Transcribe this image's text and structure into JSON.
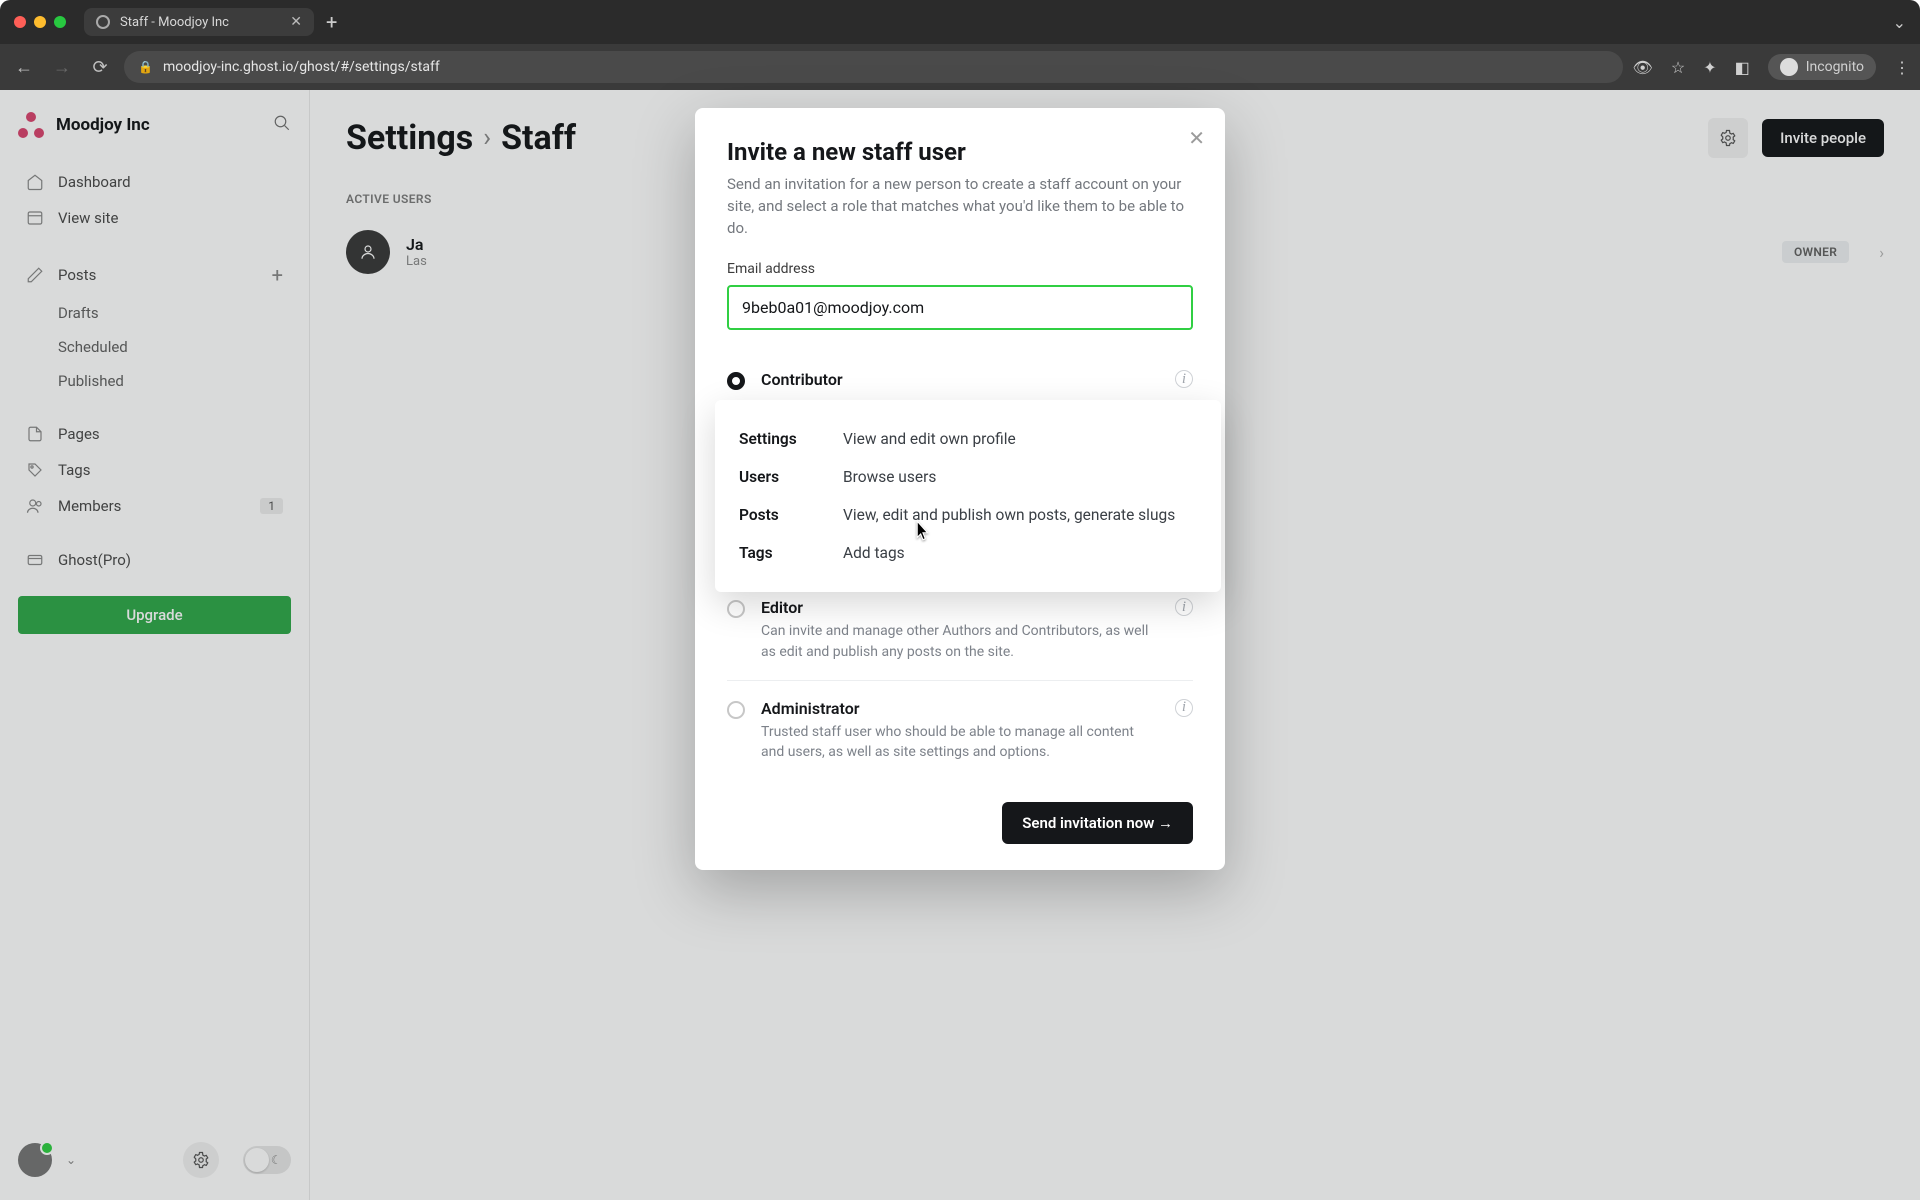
{
  "browser": {
    "tab_title": "Staff - Moodjoy Inc",
    "url": "moodjoy-inc.ghost.io/ghost/#/settings/staff",
    "incognito_label": "Incognito"
  },
  "sidebar": {
    "brand": "Moodjoy Inc",
    "items": {
      "dashboard": "Dashboard",
      "view_site": "View site",
      "posts": "Posts",
      "drafts": "Drafts",
      "scheduled": "Scheduled",
      "published": "Published",
      "pages": "Pages",
      "tags": "Tags",
      "members": "Members",
      "members_count": "1",
      "ghost_pro": "Ghost(Pro)"
    },
    "upgrade": "Upgrade"
  },
  "header": {
    "title": "Settings",
    "subtitle": "Staff",
    "invite_btn": "Invite people"
  },
  "staff": {
    "section_label": "ACTIVE USERS",
    "user_name_partial": "Ja",
    "user_meta_partial": "Las",
    "owner_badge": "OWNER"
  },
  "modal": {
    "title": "Invite a new staff user",
    "description": "Send an invitation for a new person to create a staff account on your site, and select a role that matches what you'd like them to be able to do.",
    "email_label": "Email address",
    "email_value": "9beb0a01@moodjoy.com",
    "roles": {
      "contributor": {
        "name": "Contributor",
        "perms": [
          {
            "k": "Settings",
            "v": "View and edit own profile"
          },
          {
            "k": "Users",
            "v": "Browse users"
          },
          {
            "k": "Posts",
            "v": "View, edit and publish own posts, generate slugs"
          },
          {
            "k": "Tags",
            "v": "Add tags"
          }
        ]
      },
      "editor": {
        "name": "Editor",
        "desc": "Can invite and manage other Authors and Contributors, as well as edit and publish any posts on the site."
      },
      "administrator": {
        "name": "Administrator",
        "desc": "Trusted staff user who should be able to manage all content and users, as well as site settings and options."
      }
    },
    "send_btn": "Send invitation now →"
  }
}
